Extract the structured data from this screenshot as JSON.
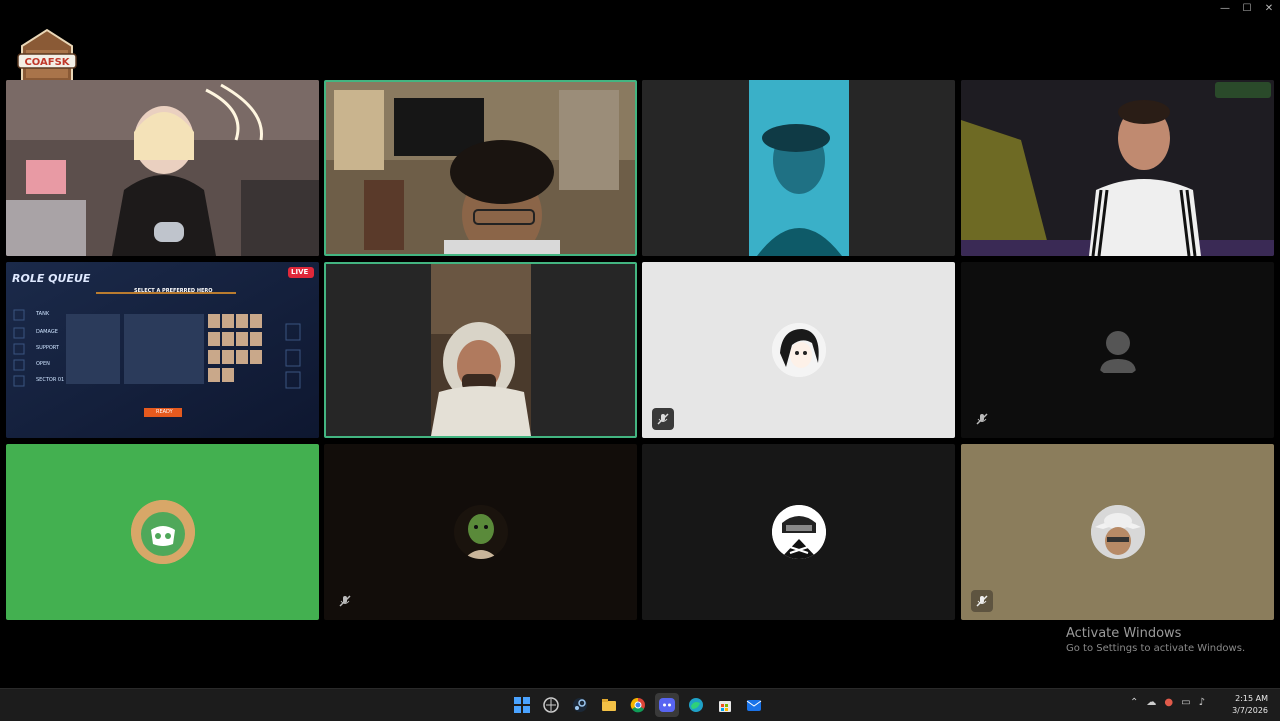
{
  "window": {
    "minimize": "—",
    "maximize": "☐",
    "close": "✕"
  },
  "logo": {
    "text": "COAFSK"
  },
  "tiles": [
    {
      "kind": "video",
      "scene": "streamer-room-pink"
    },
    {
      "kind": "video",
      "scene": "gamer-bedroom",
      "speaking": true
    },
    {
      "kind": "video",
      "scene": "blue-light-portrait"
    },
    {
      "kind": "video",
      "scene": "dark-studio"
    },
    {
      "kind": "stream",
      "scene": "role-queue",
      "live_badge": "LIVE",
      "title": "ROLE QUEUE",
      "subtitle": "SELECT A PREFERRED HERO",
      "roles": [
        "TANK",
        "DAMAGE",
        "SUPPORT",
        "OPEN",
        "SECTOR 01"
      ],
      "ready": "READY"
    },
    {
      "kind": "video",
      "scene": "hooded-man",
      "speaking": true
    },
    {
      "kind": "avatar",
      "avatar": "anime-girl-avatar",
      "bg": "#e6e6e6",
      "muted": true
    },
    {
      "kind": "avatar",
      "avatar": "default-user-icon",
      "bg": "#0d0d0d",
      "muted": true
    },
    {
      "kind": "avatar",
      "avatar": "discord-cat-avatar",
      "bg": "#43b050",
      "muted": false
    },
    {
      "kind": "avatar",
      "avatar": "goblin-avatar",
      "bg": "#120d0a",
      "muted": true
    },
    {
      "kind": "avatar",
      "avatar": "ninja-avatar",
      "bg": "#171717",
      "muted": false
    },
    {
      "kind": "avatar",
      "avatar": "cowboy-avatar",
      "bg": "#8b7d5c",
      "muted": true
    }
  ],
  "activation": {
    "title": "Activate Windows",
    "subtitle": "Go to Settings to activate Windows."
  },
  "taskbar": {
    "icons": [
      "windows-start-icon",
      "browser-icon",
      "steam-icon",
      "file-explorer-icon",
      "chrome-icon",
      "discord-icon",
      "edge-icon",
      "store-icon",
      "mail-icon"
    ],
    "active": "discord-icon"
  },
  "tray": {
    "time": "2:15 AM",
    "date": "3/7/2026"
  }
}
